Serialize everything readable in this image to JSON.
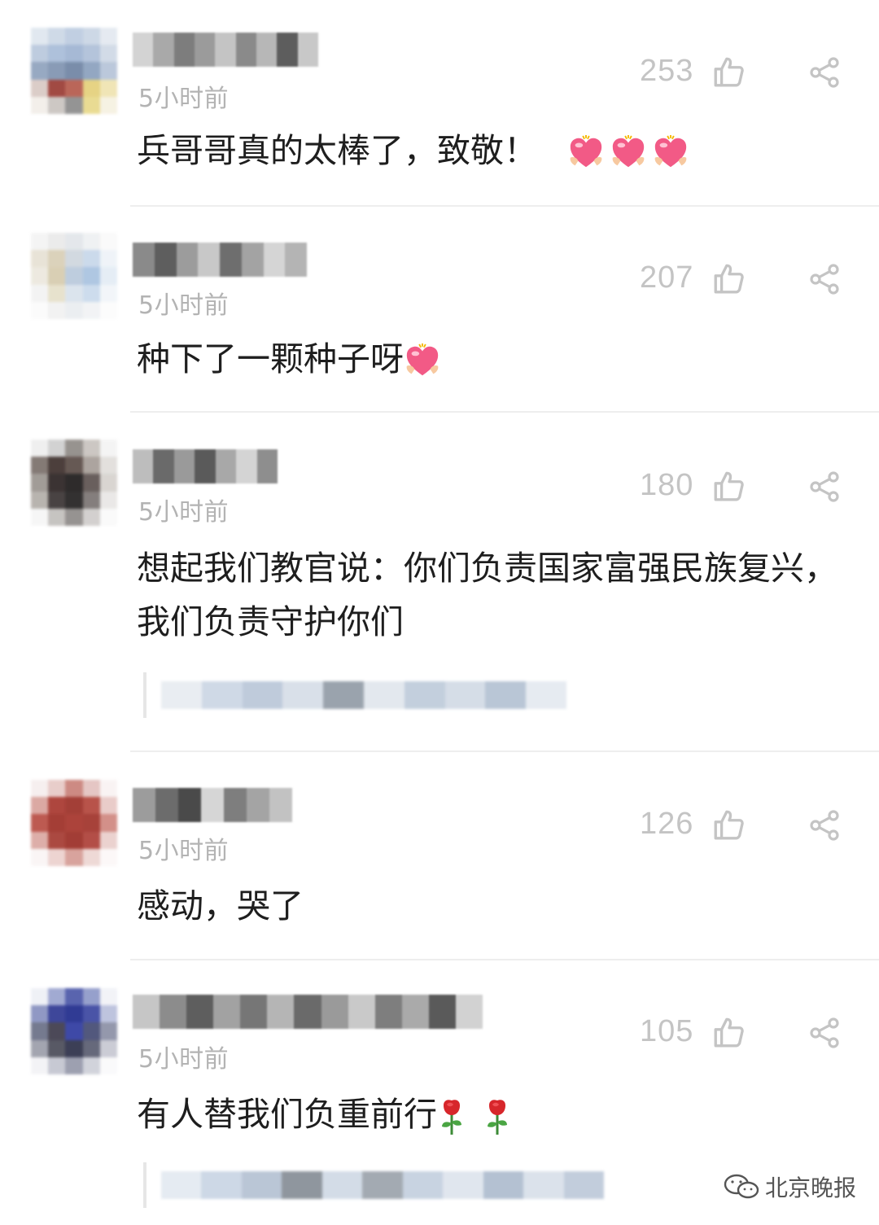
{
  "comments": [
    {
      "username": "",
      "time": "5小时前",
      "likes": "253",
      "text": "兵哥哥真的太棒了，致敬！",
      "emoji_after": [
        "heart-hug-emoji",
        "heart-hug-emoji",
        "heart-hug-emoji"
      ]
    },
    {
      "username": "",
      "time": "5小时前",
      "likes": "207",
      "text": "种下了一颗种子呀",
      "emoji_after": [
        "heart-hug-emoji"
      ]
    },
    {
      "username": "",
      "time": "5小时前",
      "likes": "180",
      "text": "想起我们教官说：你们负责国家富强民族复兴，我们负责守护你们",
      "has_reply_preview": true
    },
    {
      "username": "",
      "time": "5小时前",
      "likes": "126",
      "text": "感动，哭了"
    },
    {
      "username": "",
      "time": "5小时前",
      "likes": "105",
      "text": "有人替我们负重前行",
      "emoji_after": [
        "rose-emoji",
        "rose-emoji"
      ],
      "has_reply_preview": true
    }
  ],
  "icons": {
    "like": "thumbs-up-icon",
    "share": "share-icon",
    "watermark": "wechat-icon"
  },
  "watermark": {
    "label": "北京晚报"
  },
  "colors": {
    "meta_text": "#b3b3b3",
    "body_text": "#1e1e1e",
    "divider": "#eeeeee"
  }
}
